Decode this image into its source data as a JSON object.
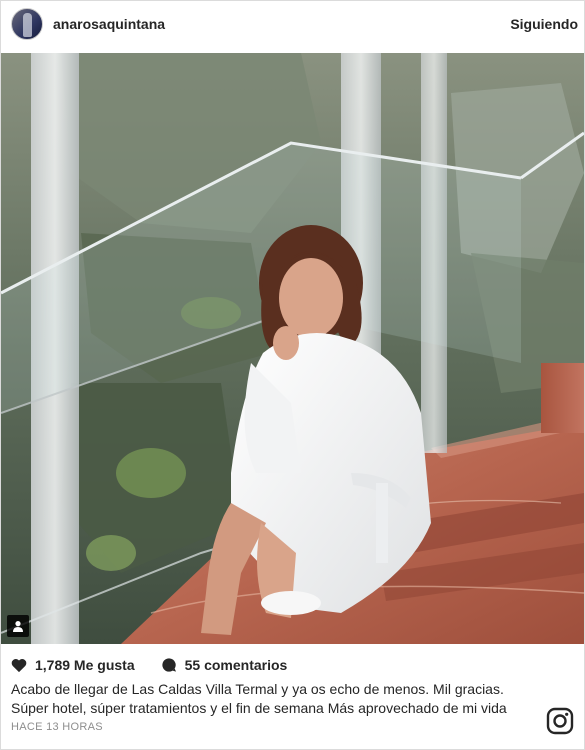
{
  "header": {
    "username": "anarosaquintana",
    "follow_status": "Siguiendo"
  },
  "post": {
    "image_alt": "",
    "likes_label": "1,789 Me gusta",
    "comments_label": "55 comentarios",
    "caption_line1": "Acabo de llegar de Las Caldas Villa Termal y ya os echo de menos. Mil gracias.",
    "caption_line2": "Súper hotel, súper tratamientos y el fin de semana Más aprovechado de mi vida",
    "timestamp": "HACE 13 HORAS"
  },
  "icons": {
    "avatar": "avatar",
    "heart": "heart-icon",
    "comment": "comment-bubble-icon",
    "user_tag": "user-tag-icon",
    "instagram": "instagram-logo-icon"
  },
  "colors": {
    "text": "#262626",
    "muted": "#8e8e8e",
    "border": "#dbdbdb"
  }
}
